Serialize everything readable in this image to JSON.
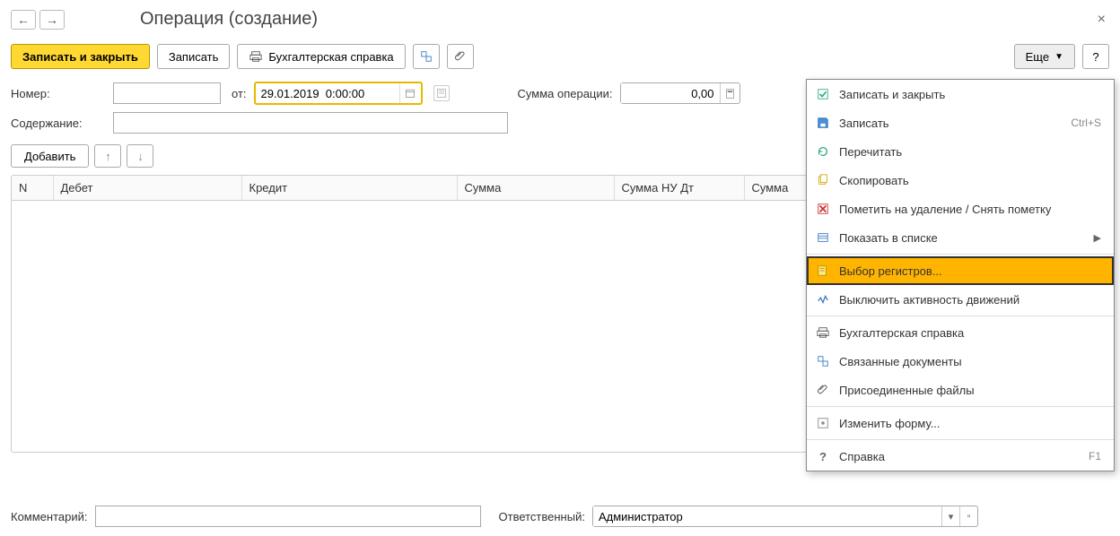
{
  "header": {
    "title": "Операция (создание)"
  },
  "toolbar": {
    "save_close": "Записать и закрыть",
    "save": "Записать",
    "report": "Бухгалтерская справка",
    "more": "Еще",
    "help": "?"
  },
  "form": {
    "number_label": "Номер:",
    "number_value": "",
    "date_label": "от:",
    "date_value": "29.01.2019  0:00:00",
    "sum_label": "Сумма операции:",
    "sum_value": "0,00",
    "content_label": "Содержание:",
    "content_value": ""
  },
  "tabtools": {
    "add": "Добавить"
  },
  "table": {
    "columns": [
      "N",
      "Дебет",
      "Кредит",
      "Сумма",
      "Сумма НУ Дт",
      "Сумма"
    ]
  },
  "footer": {
    "comment_label": "Комментарий:",
    "comment_value": "",
    "responsible_label": "Ответственный:",
    "responsible_value": "Администратор"
  },
  "menu": {
    "items": [
      {
        "label": "Записать и закрыть",
        "icon": "save-close"
      },
      {
        "label": "Записать",
        "icon": "save",
        "shortcut": "Ctrl+S"
      },
      {
        "label": "Перечитать",
        "icon": "reload"
      },
      {
        "label": "Скопировать",
        "icon": "copy"
      },
      {
        "label": "Пометить на удаление / Снять пометку",
        "icon": "delete"
      },
      {
        "label": "Показать в списке",
        "icon": "list",
        "submenu": true
      },
      {
        "label": "Выбор регистров...",
        "icon": "registers",
        "hover": true
      },
      {
        "label": "Выключить активность движений",
        "icon": "activity"
      },
      {
        "label": "Бухгалтерская справка",
        "icon": "print"
      },
      {
        "label": "Связанные документы",
        "icon": "linked"
      },
      {
        "label": "Присоединенные файлы",
        "icon": "clip"
      },
      {
        "label": "Изменить форму...",
        "icon": "form"
      },
      {
        "label": "Справка",
        "icon": "help",
        "shortcut": "F1"
      }
    ]
  }
}
